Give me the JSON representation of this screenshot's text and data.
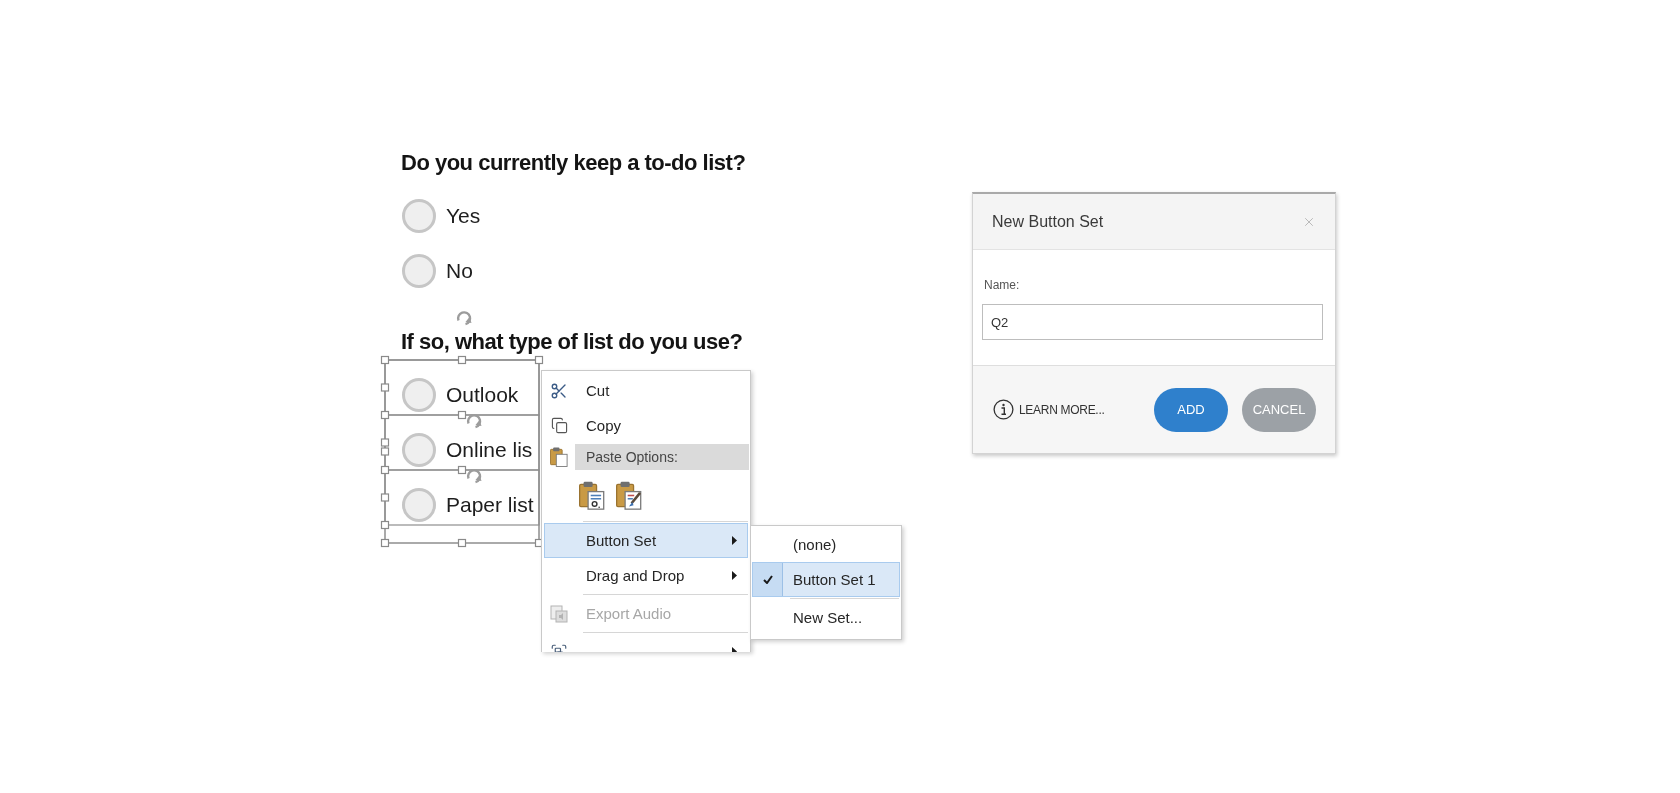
{
  "questions": [
    {
      "heading": "Do you currently keep a to-do list?",
      "selected": false,
      "options": [
        {
          "label": "Yes",
          "checked": false
        },
        {
          "label": "No",
          "checked": false
        }
      ]
    },
    {
      "heading": "If so, what type of list do you use?",
      "selected": true,
      "options": [
        {
          "label": "Outlook",
          "checked": false
        },
        {
          "label": "Online lis",
          "checked": false
        },
        {
          "label": "Paper list",
          "checked": false
        }
      ]
    }
  ],
  "context_menu": {
    "items": [
      {
        "kind": "command",
        "label": "Cut",
        "selected": false,
        "disabled": false,
        "has_submenu": false
      },
      {
        "kind": "command",
        "label": "Copy",
        "selected": false,
        "disabled": false,
        "has_submenu": false
      },
      {
        "kind": "header",
        "label": "Paste Options:"
      },
      {
        "kind": "paste_icons"
      },
      {
        "kind": "separator"
      },
      {
        "kind": "command",
        "label": "Button Set",
        "selected": true,
        "disabled": false,
        "has_submenu": true
      },
      {
        "kind": "command",
        "label": "Drag and Drop",
        "selected": false,
        "disabled": false,
        "has_submenu": true
      },
      {
        "kind": "separator"
      },
      {
        "kind": "command",
        "label": "Export Audio",
        "selected": false,
        "disabled": true,
        "has_submenu": false
      },
      {
        "kind": "separator"
      },
      {
        "kind": "clipped",
        "has_submenu": true
      }
    ]
  },
  "submenu": {
    "items": [
      {
        "kind": "option",
        "label": "(none)",
        "selected": false,
        "checked": false
      },
      {
        "kind": "option",
        "label": "Button Set 1",
        "selected": true,
        "checked": true
      },
      {
        "kind": "separator"
      },
      {
        "kind": "option",
        "label": "New Set...",
        "selected": false,
        "checked": false
      }
    ]
  },
  "dialog": {
    "title": "New Button Set",
    "field": {
      "label": "Name:",
      "value": "Q2"
    },
    "learn_more": "LEARN MORE...",
    "buttons": [
      {
        "kind": "primary",
        "label": "ADD"
      },
      {
        "kind": "secondary",
        "label": "CANCEL"
      }
    ]
  }
}
